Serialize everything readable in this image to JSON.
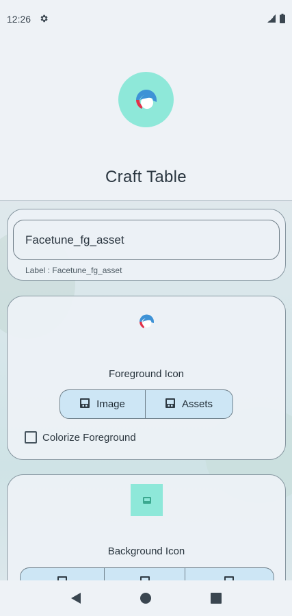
{
  "status": {
    "time": "12:26",
    "settings_icon": "gear-icon",
    "signal_icon": "signal-icon",
    "battery_icon": "battery-icon"
  },
  "app": {
    "title": "Craft Table",
    "logo_icon": "facetune-logo-icon",
    "accent": "#8ee8d9"
  },
  "label_card": {
    "input_value": "Facetune_fg_asset",
    "helper": "Label : Facetune_fg_asset"
  },
  "foreground_card": {
    "title": "Foreground Icon",
    "buttons": [
      "Image",
      "Assets"
    ],
    "checkbox_label": "Colorize Foreground",
    "checkbox_checked": false
  },
  "background_card": {
    "title": "Background Icon"
  },
  "nav": {
    "back_icon": "back-icon",
    "home_icon": "home-icon",
    "recents_icon": "recents-icon"
  }
}
